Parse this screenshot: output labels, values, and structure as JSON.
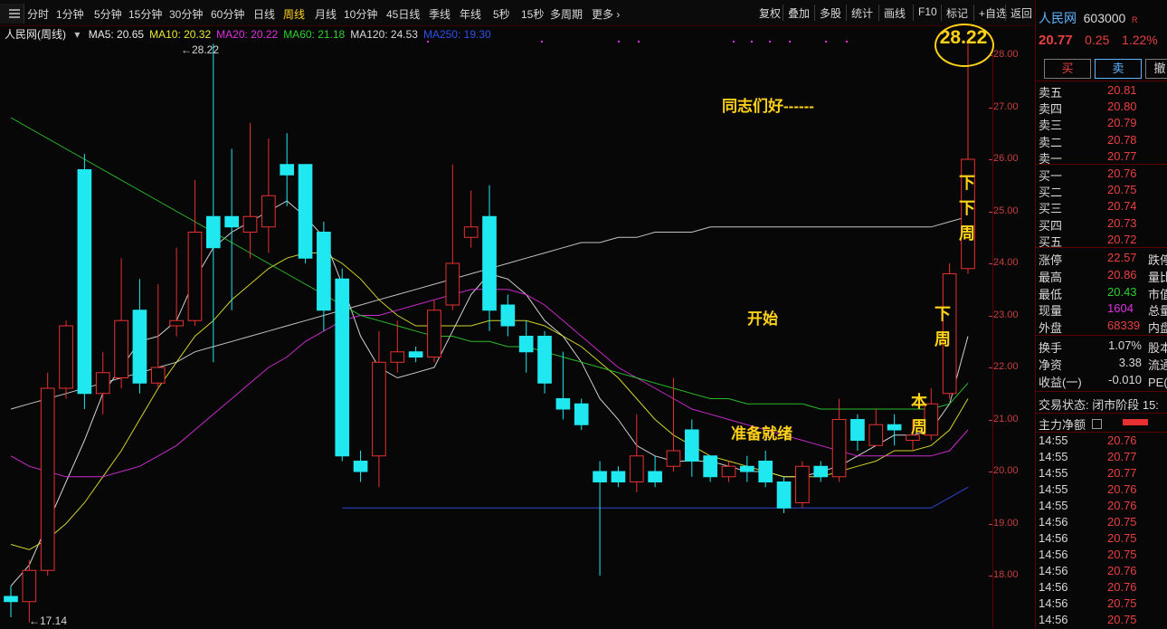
{
  "toolbar": {
    "periods": [
      "分时",
      "1分钟",
      "5分钟",
      "15分钟",
      "30分钟",
      "60分钟",
      "日线",
      "周线",
      "月线",
      "10分钟",
      "45日线",
      "季线",
      "年线",
      "5秒",
      "15秒",
      "多周期",
      "更多 ›"
    ],
    "active_period": "周线",
    "actions": [
      "复权",
      "叠加",
      "多股",
      "统计",
      "画线",
      "F10",
      "标记",
      "+自选",
      "返回"
    ]
  },
  "legend": {
    "name": "人民网(周线)",
    "ma": [
      {
        "label": "MA5: 20.65",
        "color": "#e8e8e8"
      },
      {
        "label": "MA10: 20.32",
        "color": "#e8e830"
      },
      {
        "label": "MA20: 20.22",
        "color": "#e030e0"
      },
      {
        "label": "MA60: 21.18",
        "color": "#30d030"
      },
      {
        "label": "MA120: 24.53",
        "color": "#d8d8d8"
      },
      {
        "label": "MA250: 19.30",
        "color": "#3050e8"
      }
    ]
  },
  "axis_ticks": [
    "28.00",
    "27.00",
    "26.00",
    "25.00",
    "24.00",
    "23.00",
    "22.00",
    "21.00",
    "20.00",
    "19.00",
    "18.00"
  ],
  "markers": {
    "high": "28.22",
    "low": "17.14"
  },
  "annotations": {
    "greeting": "同志们好------",
    "start": "开始",
    "ready": "准备就绪",
    "circle": "28.22",
    "next_next_week": [
      "下",
      "下",
      "周"
    ],
    "next_week": [
      "下",
      "周"
    ],
    "this_week": [
      "本",
      "周"
    ]
  },
  "chart_data": {
    "type": "candlestick",
    "period": "weekly",
    "ylim": [
      17.14,
      28.22
    ],
    "candles": [
      [
        17.6,
        17.5,
        17.8,
        17.2
      ],
      [
        17.5,
        18.1,
        18.3,
        17.1
      ],
      [
        18.1,
        21.6,
        21.9,
        18.0
      ],
      [
        21.6,
        22.8,
        22.9,
        21.4
      ],
      [
        25.8,
        21.5,
        26.1,
        21.2
      ],
      [
        21.5,
        21.9,
        22.3,
        21.1
      ],
      [
        21.8,
        22.9,
        24.1,
        21.6
      ],
      [
        23.1,
        21.7,
        23.7,
        21.5
      ],
      [
        21.7,
        22.0,
        23.6,
        21.6
      ],
      [
        22.8,
        22.9,
        24.3,
        22.6
      ],
      [
        22.9,
        24.6,
        25.6,
        22.8
      ],
      [
        24.9,
        24.3,
        28.22,
        22.1
      ],
      [
        24.9,
        24.7,
        26.2,
        23.1
      ],
      [
        24.6,
        24.9,
        26.7,
        24.1
      ],
      [
        24.7,
        25.3,
        26.4,
        24.2
      ],
      [
        25.9,
        25.7,
        26.5,
        25.1
      ],
      [
        25.9,
        24.1,
        25.7,
        24.0
      ],
      [
        24.6,
        23.1,
        24.8,
        22.7
      ],
      [
        23.7,
        20.3,
        23.9,
        20.2
      ],
      [
        20.2,
        20.0,
        20.4,
        19.8
      ],
      [
        20.3,
        22.1,
        22.7,
        19.7
      ],
      [
        22.1,
        22.3,
        22.9,
        21.9
      ],
      [
        22.3,
        22.2,
        22.4,
        22.1
      ],
      [
        22.2,
        23.1,
        23.3,
        22.1
      ],
      [
        23.2,
        24.0,
        25.9,
        23.1
      ],
      [
        24.5,
        24.7,
        25.4,
        24.3
      ],
      [
        24.9,
        23.1,
        25.5,
        22.7
      ],
      [
        23.2,
        22.8,
        23.4,
        22.6
      ],
      [
        22.6,
        22.3,
        22.9,
        21.9
      ],
      [
        22.6,
        21.7,
        22.7,
        21.5
      ],
      [
        21.4,
        21.2,
        22.3,
        21.0
      ],
      [
        21.3,
        20.9,
        21.4,
        20.8
      ],
      [
        20.0,
        19.8,
        20.2,
        18.0
      ],
      [
        20.0,
        19.8,
        20.1,
        19.7
      ],
      [
        19.8,
        20.3,
        21.1,
        19.6
      ],
      [
        20.0,
        19.8,
        20.3,
        19.7
      ],
      [
        20.1,
        20.4,
        21.8,
        20.0
      ],
      [
        20.8,
        20.2,
        21.0,
        19.9
      ],
      [
        20.3,
        19.9,
        20.2,
        19.8
      ],
      [
        19.9,
        20.1,
        20.2,
        19.8
      ],
      [
        20.1,
        20.0,
        20.3,
        19.8
      ],
      [
        20.2,
        19.8,
        20.4,
        19.7
      ],
      [
        19.8,
        19.3,
        19.9,
        19.2
      ],
      [
        19.4,
        20.1,
        20.2,
        19.3
      ],
      [
        20.1,
        19.9,
        20.2,
        19.8
      ],
      [
        19.9,
        21.0,
        21.4,
        19.8
      ],
      [
        21.0,
        20.6,
        21.1,
        20.4
      ],
      [
        20.5,
        20.9,
        21.2,
        20.5
      ],
      [
        20.9,
        20.8,
        21.1,
        20.5
      ],
      [
        20.6,
        20.7,
        21.0,
        20.4
      ],
      [
        20.7,
        21.3,
        21.6,
        20.6
      ],
      [
        21.5,
        23.8,
        24.0,
        21.4
      ],
      [
        23.9,
        26.0,
        28.22,
        23.8
      ]
    ],
    "ma_lines": {
      "MA5": [
        17.8,
        18.2,
        19.0,
        19.8,
        20.6,
        21.5,
        22.0,
        22.5,
        22.6,
        22.9,
        23.7,
        24.3,
        24.6,
        24.8,
        25.0,
        25.2,
        24.9,
        24.5,
        23.6,
        22.6,
        22.0,
        21.8,
        21.9,
        22.0,
        22.7,
        23.4,
        23.8,
        23.7,
        23.4,
        22.9,
        22.6,
        22.1,
        21.4,
        21.0,
        20.5,
        20.3,
        20.2,
        20.2,
        20.2,
        20.1,
        20.0,
        20.0,
        19.9,
        19.9,
        20.0,
        20.1,
        20.3,
        20.5,
        20.7,
        20.7,
        20.8,
        21.3,
        22.6
      ],
      "MA10": [
        18.6,
        18.5,
        18.7,
        19.0,
        19.4,
        19.9,
        20.4,
        21.0,
        21.6,
        22.1,
        22.6,
        22.9,
        23.3,
        23.6,
        23.9,
        24.1,
        24.2,
        24.2,
        24.0,
        23.7,
        23.3,
        23.0,
        22.8,
        22.8,
        22.8,
        22.8,
        22.9,
        22.9,
        22.9,
        22.8,
        22.6,
        22.4,
        22.1,
        21.8,
        21.4,
        21.0,
        20.7,
        20.5,
        20.3,
        20.2,
        20.1,
        20.0,
        19.9,
        19.9,
        19.9,
        20.0,
        20.1,
        20.2,
        20.4,
        20.4,
        20.5,
        20.8,
        21.4
      ],
      "MA20": [
        20.3,
        20.1,
        20.0,
        19.9,
        19.9,
        19.9,
        20.0,
        20.1,
        20.3,
        20.5,
        20.8,
        21.1,
        21.4,
        21.7,
        22.0,
        22.2,
        22.5,
        22.7,
        22.9,
        23.0,
        23.0,
        23.1,
        23.2,
        23.3,
        23.4,
        23.5,
        23.5,
        23.5,
        23.4,
        23.2,
        22.9,
        22.6,
        22.3,
        22.0,
        21.8,
        21.6,
        21.4,
        21.2,
        21.1,
        21.0,
        20.9,
        20.8,
        20.7,
        20.6,
        20.5,
        20.4,
        20.3,
        20.3,
        20.3,
        20.3,
        20.3,
        20.4,
        20.8
      ],
      "MA60": [
        26.8,
        26.6,
        26.4,
        26.2,
        26.0,
        25.8,
        25.6,
        25.4,
        25.2,
        25.0,
        24.8,
        24.6,
        24.4,
        24.2,
        24.0,
        23.8,
        23.6,
        23.4,
        23.2,
        23.0,
        22.9,
        22.8,
        22.7,
        22.6,
        22.6,
        22.5,
        22.5,
        22.4,
        22.4,
        22.3,
        22.2,
        22.1,
        22.0,
        21.9,
        21.8,
        21.7,
        21.6,
        21.5,
        21.4,
        21.4,
        21.3,
        21.3,
        21.3,
        21.3,
        21.2,
        21.2,
        21.2,
        21.2,
        21.2,
        21.2,
        21.2,
        21.3,
        21.7
      ],
      "MA120": [
        21.2,
        21.3,
        21.4,
        21.5,
        21.6,
        21.7,
        21.8,
        21.9,
        22.0,
        22.1,
        22.3,
        22.4,
        22.5,
        22.6,
        22.7,
        22.8,
        22.9,
        23.0,
        23.1,
        23.2,
        23.3,
        23.4,
        23.5,
        23.6,
        23.7,
        23.8,
        23.9,
        24.0,
        24.1,
        24.2,
        24.3,
        24.4,
        24.4,
        24.5,
        24.5,
        24.6,
        24.6,
        24.6,
        24.7,
        24.7,
        24.7,
        24.7,
        24.7,
        24.7,
        24.7,
        24.7,
        24.7,
        24.7,
        24.7,
        24.7,
        24.7,
        24.8,
        24.9
      ],
      "MA250": [
        null,
        null,
        null,
        null,
        null,
        null,
        null,
        null,
        null,
        null,
        null,
        null,
        null,
        null,
        null,
        null,
        null,
        null,
        19.3,
        19.3,
        19.3,
        19.3,
        19.3,
        19.3,
        19.3,
        19.3,
        19.3,
        19.3,
        19.3,
        19.3,
        19.3,
        19.3,
        19.3,
        19.3,
        19.3,
        19.3,
        19.3,
        19.3,
        19.3,
        19.3,
        19.3,
        19.3,
        19.3,
        19.3,
        19.3,
        19.3,
        19.3,
        19.3,
        19.3,
        19.3,
        19.3,
        19.5,
        19.7
      ]
    },
    "colors": {
      "up": "#e83030",
      "down": "#20e8f0",
      "MA5": "#e8e8e8",
      "MA10": "#e8e830",
      "MA20": "#e030e0",
      "MA60": "#30d030",
      "MA120": "#d8d8d8",
      "MA250": "#3050e8"
    }
  },
  "panel": {
    "title": "人民网",
    "code": "603000",
    "r_badge": "R",
    "price": "20.77",
    "change": "0.25",
    "pct": "1.22%",
    "buttons": [
      "买",
      "卖",
      "撤"
    ],
    "asks": [
      {
        "label": "卖五",
        "price": "20.81"
      },
      {
        "label": "卖四",
        "price": "20.80"
      },
      {
        "label": "卖三",
        "price": "20.79"
      },
      {
        "label": "卖二",
        "price": "20.78"
      },
      {
        "label": "卖一",
        "price": "20.77"
      }
    ],
    "bids": [
      {
        "label": "买一",
        "price": "20.76"
      },
      {
        "label": "买二",
        "price": "20.75"
      },
      {
        "label": "买三",
        "price": "20.74"
      },
      {
        "label": "买四",
        "price": "20.73"
      },
      {
        "label": "买五",
        "price": "20.72"
      }
    ],
    "stats": [
      {
        "label": "涨停",
        "value": "22.57",
        "extra": "跌停",
        "color": "#e84040"
      },
      {
        "label": "最高",
        "value": "20.86",
        "extra": "量比",
        "color": "#e84040"
      },
      {
        "label": "最低",
        "value": "20.43",
        "extra": "市值",
        "color": "#30d030"
      },
      {
        "label": "现量",
        "value": "1604",
        "extra": "总量",
        "color": "#e030e0"
      },
      {
        "label": "外盘",
        "value": "68339",
        "extra": "内盘",
        "color": "#e84040"
      }
    ],
    "stats2": [
      {
        "label": "换手",
        "value": "1.07%",
        "extra": "股本"
      },
      {
        "label": "净资",
        "value": "3.38",
        "extra": "流通"
      },
      {
        "label": "收益(一)",
        "value": "-0.010",
        "extra": "PE(动"
      }
    ],
    "status": "交易状态: 闭市阶段 15:",
    "net_label": "主力净额",
    "ticks": [
      {
        "time": "14:55",
        "price": "20.76"
      },
      {
        "time": "14:55",
        "price": "20.77"
      },
      {
        "time": "14:55",
        "price": "20.77"
      },
      {
        "time": "14:55",
        "price": "20.76"
      },
      {
        "time": "14:55",
        "price": "20.76"
      },
      {
        "time": "14:56",
        "price": "20.75"
      },
      {
        "time": "14:56",
        "price": "20.75"
      },
      {
        "time": "14:56",
        "price": "20.75"
      },
      {
        "time": "14:56",
        "price": "20.76"
      },
      {
        "time": "14:56",
        "price": "20.76"
      },
      {
        "time": "14:56",
        "price": "20.75"
      },
      {
        "time": "14:56",
        "price": "20.75"
      }
    ]
  }
}
